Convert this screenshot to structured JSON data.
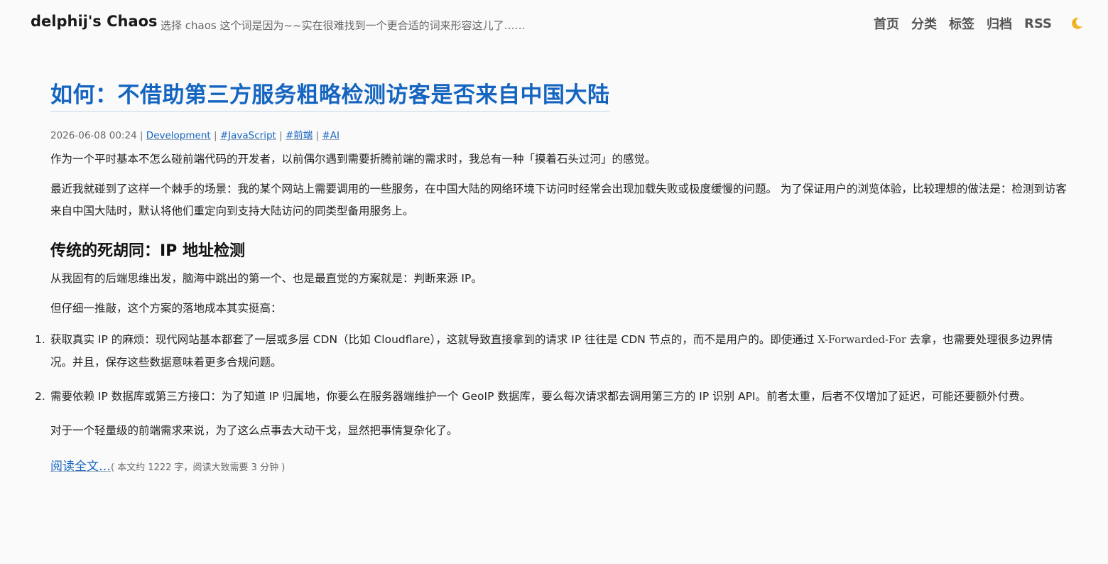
{
  "header": {
    "site_title": "delphij's Chaos",
    "site_description": "选择 chaos 这个词是因为~~实在很难找到一个更合适的词来形容这儿了……",
    "nav": [
      {
        "label": "首页"
      },
      {
        "label": "分类"
      },
      {
        "label": "标签"
      },
      {
        "label": "归档"
      },
      {
        "label": "RSS"
      }
    ],
    "theme_toggle_icon": "moon-icon"
  },
  "post": {
    "title": "如何：不借助第三方服务粗略检测访客是否来自中国大陆",
    "meta": {
      "date": "2026-06-08 00:24",
      "separator": " | ",
      "category": "Development",
      "tags": [
        "#JavaScript",
        "#前端",
        "#AI"
      ]
    },
    "paragraphs": [
      "作为一个平时基本不怎么碰前端代码的开发者，以前偶尔遇到需要折腾前端的需求时，我总有一种「摸着石头过河」的感觉。",
      "最近我就碰到了这样一个棘手的场景：我的某个网站上需要调用的一些服务，在中国大陆的网络环境下访问时经常会出现加载失败或极度缓慢的问题。 为了保证用户的浏览体验，比较理想的做法是：检测到访客来自中国大陆时，默认将他们重定向到支持大陆访问的同类型备用服务上。"
    ],
    "section_heading": "传统的死胡同：IP 地址检测",
    "section_paragraphs": [
      "从我固有的后端思维出发，脑海中跳出的第一个、也是最直觉的方案就是：判断来源 IP。",
      "但仔细一推敲，这个方案的落地成本其实挺高："
    ],
    "list": [
      {
        "num": "1.",
        "before": "获取真实 IP 的麻烦：现代网站基本都套了一层或多层 CDN（比如 Cloudflare），这就导致直接拿到的请求 IP 往往是 CDN 节点的，而不是用户的。即使通过 ",
        "code": "X-Forwarded-For",
        "after": " 去拿，也需要处理很多边界情况。并且，保存这些数据意味着更多合规问题。"
      },
      {
        "num": "2.",
        "before": "需要依赖 IP 数据库或第三方接口：为了知道 IP 归属地，你要么在服务器端维护一个 GeoIP 数据库，要么每次请求都去调用第三方的 IP 识别 API。前者太重，后者不仅增加了延迟，可能还要额外付费。",
        "code": "",
        "after": ""
      }
    ],
    "closing_paragraph": "对于一个轻量级的前端需求来说，为了这么点事去大动干戈，显然把事情复杂化了。",
    "read_more": {
      "label": "阅读全文…",
      "word_count": "( 本文约 1222 字，阅读大致需要 3 分钟 )"
    }
  }
}
